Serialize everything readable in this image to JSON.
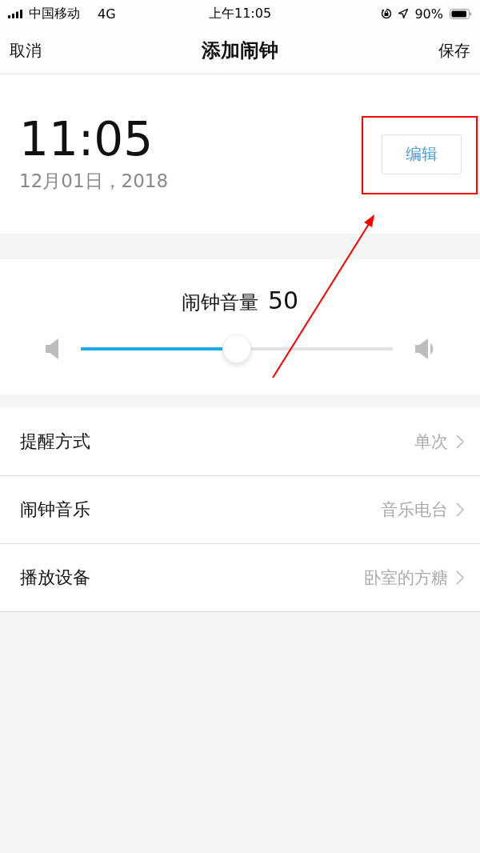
{
  "status_bar": {
    "carrier": "中国移动",
    "network": "4G",
    "time": "上午11:05",
    "battery": "90%"
  },
  "nav": {
    "cancel": "取消",
    "title": "添加闹钟",
    "save": "保存"
  },
  "alarm": {
    "time": "11:05",
    "date": "12月01日，2018",
    "edit_button": "编辑"
  },
  "volume": {
    "label": "闹钟音量",
    "value": "50",
    "level": 0.5
  },
  "settings": [
    {
      "label": "提醒方式",
      "value": "单次"
    },
    {
      "label": "闹钟音乐",
      "value": "音乐电台"
    },
    {
      "label": "播放设备",
      "value": "卧室的方糖"
    }
  ]
}
